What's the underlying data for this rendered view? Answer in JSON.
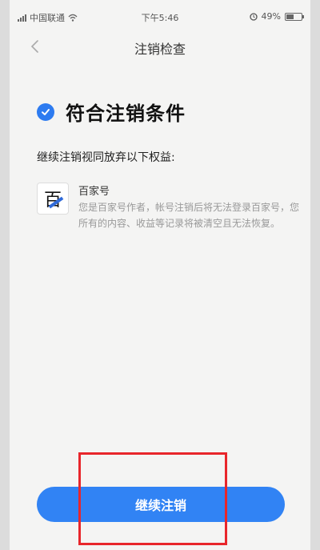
{
  "status_bar": {
    "carrier": "中国联通",
    "time": "下午5:46",
    "battery_percent": "49%",
    "battery_level": 0.49
  },
  "nav": {
    "title": "注销检查",
    "back_icon": "chevron-left-icon"
  },
  "result": {
    "icon": "check-circle-icon",
    "heading": "符合注销条件"
  },
  "subheading": "继续注销视同放弃以下权益:",
  "benefits": [
    {
      "logo_text": "百",
      "title": "百家号",
      "description": "您是百家号作者，帐号注销后将无法登录百家号，您所有的内容、收益等记录将被清空且无法恢复。"
    }
  ],
  "actions": {
    "continue_label": "继续注销"
  },
  "colors": {
    "accent": "#3183f4",
    "highlight": "#e8262b"
  }
}
